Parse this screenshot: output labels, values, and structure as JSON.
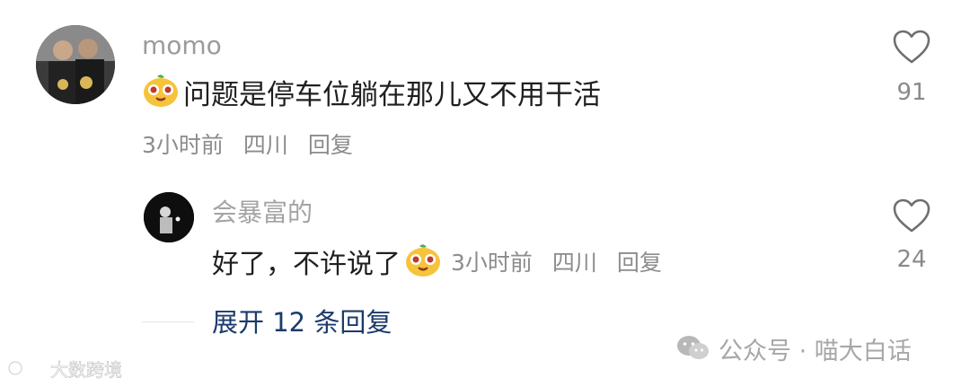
{
  "comment": {
    "username": "momo",
    "text": "问题是停车位躺在那儿又不用干活",
    "time": "3小时前",
    "location": "四川",
    "reply_label": "回复",
    "like_count": "91"
  },
  "reply": {
    "username": "会暴富的",
    "text": "好了，不许说了",
    "time": "3小时前",
    "location": "四川",
    "reply_label": "回复",
    "like_count": "24"
  },
  "expand_replies": "展开 12 条回复",
  "watermark_wechat": "公众号 · 喵大白话",
  "watermark_corner": "大数跨境",
  "colors": {
    "link": "#1b3a6d",
    "muted": "#9b9b9b",
    "emoji_yellow": "#f6c33b"
  },
  "icons": {
    "like": "heart-outline-icon",
    "emoji": "smiling-face-emoji",
    "wechat": "wechat-icon",
    "corner_logo": "circle-logo-icon"
  }
}
